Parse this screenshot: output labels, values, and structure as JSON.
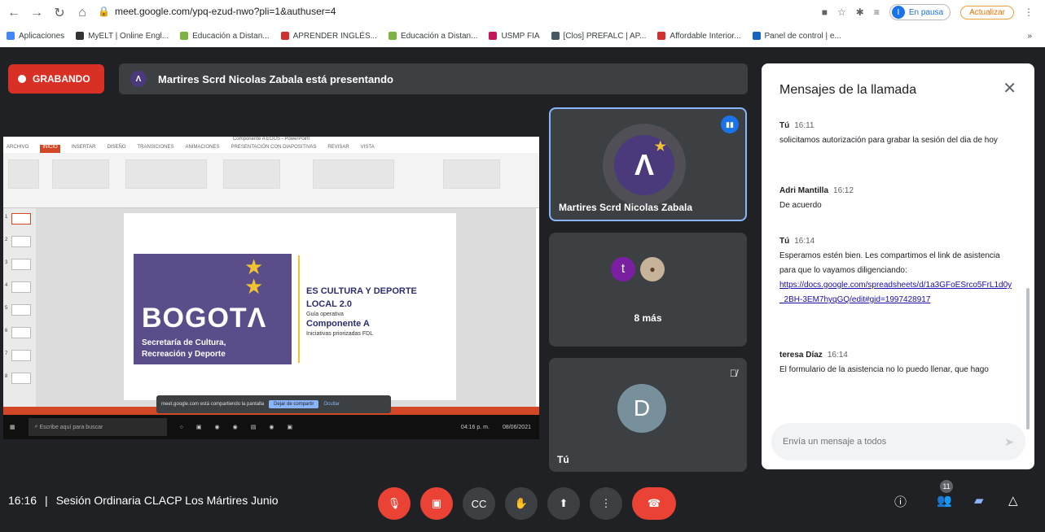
{
  "browser": {
    "url": "meet.google.com/ypq-ezud-nwo?pli=1&authuser=4",
    "status_pill": "En pausa",
    "avatar_initial": "I",
    "update_label": "Actualizar",
    "bookmarks": [
      {
        "label": "Aplicaciones",
        "color": "#4285f4"
      },
      {
        "label": "MyELT | Online Engl...",
        "color": "#333333"
      },
      {
        "label": "Educación a Distan...",
        "color": "#7cb342"
      },
      {
        "label": "APRENDER INGLÉS...",
        "color": "#d32f2f"
      },
      {
        "label": "Educación a Distan...",
        "color": "#7cb342"
      },
      {
        "label": "USMP FIA",
        "color": "#c2185b"
      },
      {
        "label": "[Clos] PREFALC | AP...",
        "color": "#455a64"
      },
      {
        "label": "Affordable Interior...",
        "color": "#d32f2f"
      },
      {
        "label": "Panel de control | e...",
        "color": "#1565c0"
      }
    ],
    "more_bookmarks": "»"
  },
  "meet": {
    "recording_label": "GRABANDO",
    "presenting_text": "Martires Scrd Nicolas Zabala está presentando",
    "slide": {
      "window_title": "Componente A EGÜS - PowerPoint",
      "tabs": [
        "ARCHIVO",
        "INICIO",
        "INSERTAR",
        "DISEÑO",
        "TRANSICIONES",
        "ANIMACIONES",
        "PRESENTACIÓN CON DIAPOSITIVAS",
        "REVISAR",
        "VISTA"
      ],
      "thumb_numbers": [
        "1",
        "2",
        "3",
        "4",
        "5",
        "6",
        "7",
        "8"
      ],
      "logo_text": "BOGOTΛ",
      "logo_sub1": "Secretaría de Cultura,",
      "logo_sub2": "Recreación y Deporte",
      "line1": "ES CULTURA Y DEPORTE",
      "line2": "LOCAL 2.0",
      "line3": "Guía operativa",
      "line4": "Componente A",
      "line5": "Iniciativas priorizadas FDL",
      "sharebar_text": "meet.google.com está compartiendo la pantalla",
      "stop_label": "Dejar de compartir",
      "hide_label": "Ocultar",
      "task_search": "Escribe aquí para buscar",
      "task_time": "04:16 p. m.",
      "task_date": "08/06/2021"
    },
    "tiles": [
      {
        "name": "Martires Scrd Nicolas Zabala"
      },
      {
        "avatar_initial": "t",
        "more_label": "8 más"
      },
      {
        "avatar_initial": "D",
        "name": "Tú"
      }
    ]
  },
  "chat": {
    "title": "Mensajes de la llamada",
    "messages": [
      {
        "sender": "Tú",
        "time": "16:11",
        "text": "solicitamos autorización para grabar la sesión del dia de hoy",
        "link": ""
      },
      {
        "sender": "Adri Mantilla",
        "time": "16:12",
        "text": "De acuerdo",
        "link": ""
      },
      {
        "sender": "Tú",
        "time": "16:14",
        "text": "Esperamos estén bien. Les compartimos el link de asistencia para que lo vayamos diligenciando:",
        "link": "https://docs.google.com/spreadsheets/d/1a3GFoESrco5FrL1d0y_2BH-3EM7hyqGQ/edit#gid=1997428917"
      },
      {
        "sender": "teresa Díaz",
        "time": "16:14",
        "text": "El formulario de la asistencia no lo puedo llenar, que hago",
        "link": ""
      }
    ],
    "input_placeholder": "Envía un mensaje a todos"
  },
  "bottom": {
    "time": "16:16",
    "separator": "|",
    "meeting_name": "Sesión Ordinaria CLACP Los Mártires Junio",
    "participants_count": "11"
  },
  "colors": {
    "accent": "#1a73e8",
    "danger": "#ea4335",
    "surface": "#3c4043",
    "background": "#202124"
  }
}
